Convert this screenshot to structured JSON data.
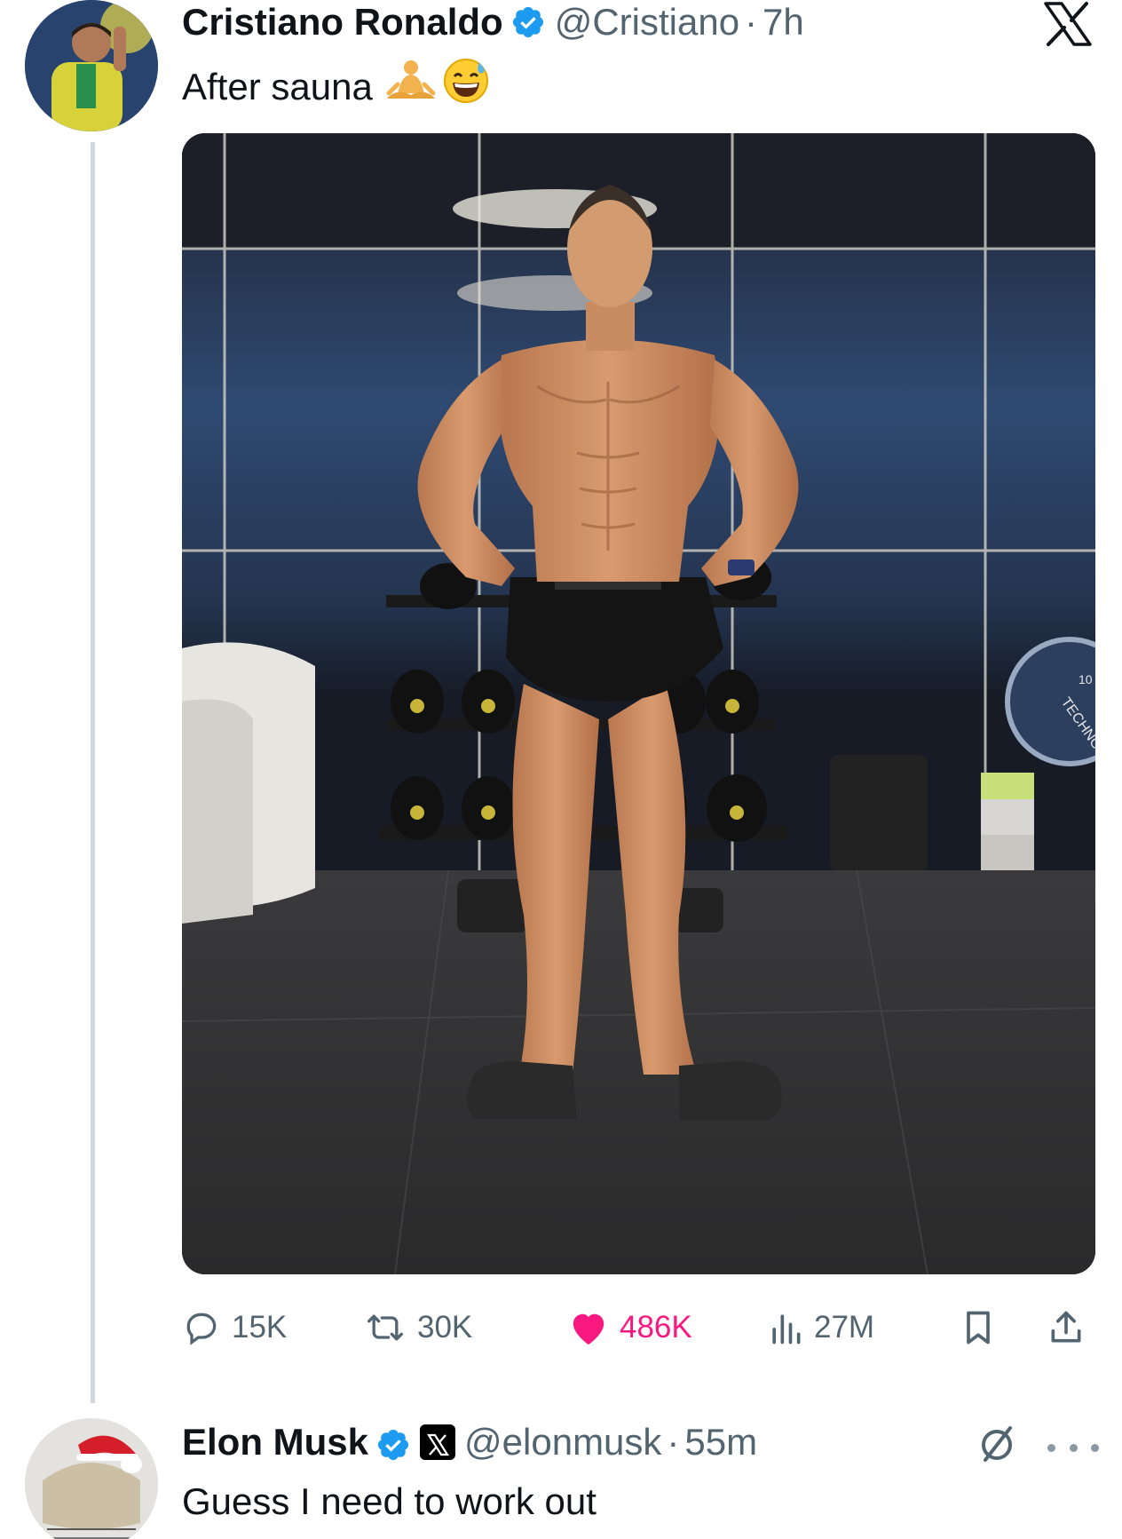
{
  "post": {
    "author_name": "Cristiano Ronaldo",
    "author_handle": "@Cristiano",
    "separator": "·",
    "time": "7h",
    "text": "After sauna",
    "emojis": [
      "person-in-lotus-position-emoji",
      "grinning-face-with-sweat-emoji"
    ],
    "verified_color": "#1d9bf0",
    "photo_labels": {
      "weight_plate": "TECHNOFIT",
      "plate_number": "10"
    },
    "stats": {
      "replies": "15K",
      "reposts": "30K",
      "likes": "486K",
      "views": "27M"
    },
    "like_color": "#f91880"
  },
  "reply": {
    "author_name": "Elon Musk",
    "author_handle": "@elonmusk",
    "separator": "·",
    "time": "55m",
    "text": "Guess I need to work out"
  },
  "icons": {
    "platform": "x-logo-icon",
    "reply": "speech-bubble-icon",
    "repost": "repost-arrows-icon",
    "like": "heart-icon",
    "views": "bar-chart-icon",
    "bookmark": "bookmark-icon",
    "share": "share-upload-icon",
    "grok": "grok-slash-circle-icon",
    "more": "more-dots-icon"
  }
}
